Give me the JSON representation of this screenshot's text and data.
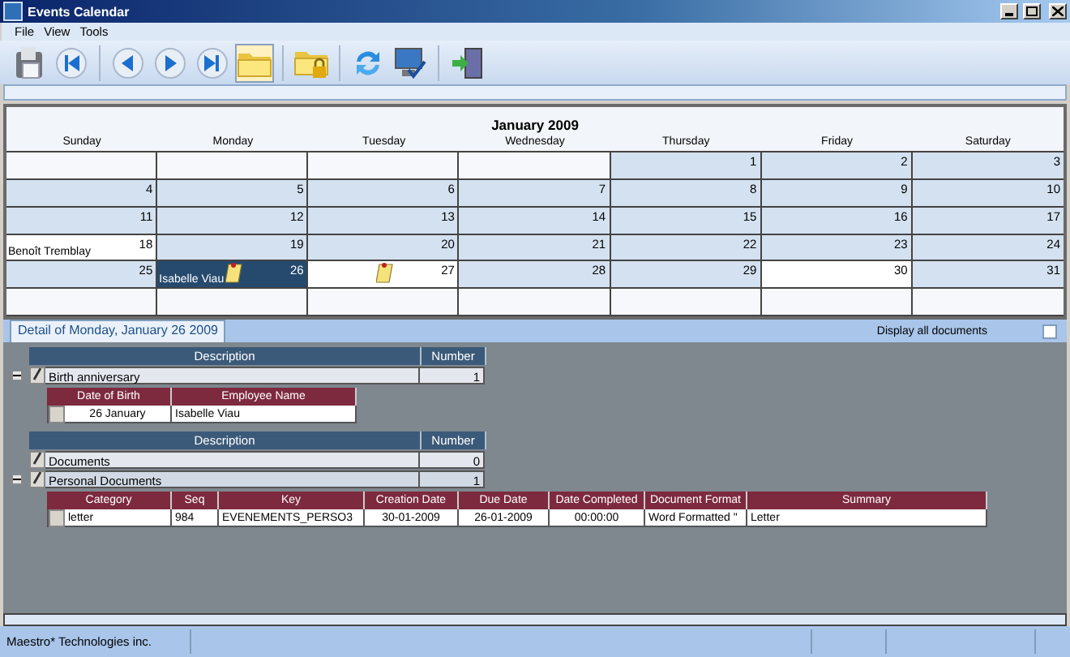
{
  "window": {
    "title": "Events Calendar"
  },
  "menu": [
    "File",
    "View",
    "Tools"
  ],
  "toolbar": [
    {
      "kind": "print",
      "selected": false
    },
    {
      "kind": "first",
      "selected": false
    },
    {
      "kind": "prev",
      "selected": false
    },
    {
      "kind": "next",
      "selected": false
    },
    {
      "kind": "last",
      "selected": false
    },
    {
      "kind": "folder",
      "selected": true
    },
    {
      "kind": "lockfolder",
      "selected": false
    },
    {
      "kind": "refresh",
      "selected": false
    },
    {
      "kind": "monitor",
      "selected": false
    },
    {
      "kind": "exit",
      "selected": false
    }
  ],
  "calendar": {
    "title": "January 2009",
    "days": [
      "Sunday",
      "Monday",
      "Tuesday",
      "Wednesday",
      "Thursday",
      "Friday",
      "Saturday"
    ],
    "weeks": [
      [
        {
          "kind": "blank"
        },
        {
          "kind": "blank"
        },
        {
          "kind": "blank"
        },
        {
          "kind": "blank"
        },
        {
          "kind": "month",
          "day": "1"
        },
        {
          "kind": "month",
          "day": "2"
        },
        {
          "kind": "month",
          "day": "3"
        }
      ],
      [
        {
          "kind": "month",
          "day": "4"
        },
        {
          "kind": "month",
          "day": "5"
        },
        {
          "kind": "month",
          "day": "6"
        },
        {
          "kind": "month",
          "day": "7"
        },
        {
          "kind": "month",
          "day": "8"
        },
        {
          "kind": "month",
          "day": "9"
        },
        {
          "kind": "month",
          "day": "10"
        }
      ],
      [
        {
          "kind": "month",
          "day": "11"
        },
        {
          "kind": "month",
          "day": "12"
        },
        {
          "kind": "month",
          "day": "13"
        },
        {
          "kind": "month",
          "day": "14"
        },
        {
          "kind": "month",
          "day": "15"
        },
        {
          "kind": "month",
          "day": "16"
        },
        {
          "kind": "month",
          "day": "17"
        }
      ],
      [
        {
          "kind": "marked",
          "day": "18",
          "event": "Benoît Tremblay"
        },
        {
          "kind": "month",
          "day": "19"
        },
        {
          "kind": "month",
          "day": "20"
        },
        {
          "kind": "month",
          "day": "21"
        },
        {
          "kind": "month",
          "day": "22"
        },
        {
          "kind": "month",
          "day": "23"
        },
        {
          "kind": "month",
          "day": "24"
        }
      ],
      [
        {
          "kind": "month",
          "day": "25"
        },
        {
          "kind": "month",
          "day": "26",
          "event": "Isabelle Viau",
          "note": true,
          "selected": true
        },
        {
          "kind": "marked",
          "day": "27",
          "note": true
        },
        {
          "kind": "month",
          "day": "28"
        },
        {
          "kind": "month",
          "day": "29"
        },
        {
          "kind": "marked",
          "day": "30"
        },
        {
          "kind": "month",
          "day": "31"
        }
      ],
      [
        {
          "kind": "blank"
        },
        {
          "kind": "blank"
        },
        {
          "kind": "blank"
        },
        {
          "kind": "blank"
        },
        {
          "kind": "blank"
        },
        {
          "kind": "blank"
        },
        {
          "kind": "blank"
        }
      ]
    ]
  },
  "detail": {
    "tab": "Detail of Monday, January 26 2009",
    "display_all": {
      "label": "Display all documents",
      "checked": false
    },
    "groups": [
      {
        "columns": [
          "Description",
          "Number"
        ],
        "rows": [
          {
            "description": "Birth anniversary",
            "number": "1",
            "expanded": true,
            "sub": {
              "columns": [
                "Date of Birth",
                "Employee Name"
              ],
              "rows": [
                [
                  "26 January",
                  "Isabelle Viau"
                ]
              ]
            }
          }
        ]
      },
      {
        "columns": [
          "Description",
          "Number"
        ],
        "rows": [
          {
            "description": "Documents",
            "number": "0"
          },
          {
            "description": "Personal Documents",
            "number": "1",
            "expanded": true,
            "sub": {
              "columns": [
                "Category",
                "Seq",
                "Key",
                "Creation Date",
                "Due Date",
                "Date Completed",
                "Document Format",
                "Summary"
              ],
              "rows": [
                [
                  "letter",
                  "984",
                  "EVENEMENTS_PERSO3",
                  "30-01-2009",
                  "26-01-2009",
                  "00:00:00",
                  "Word Formatted \"",
                  "Letter"
                ]
              ]
            }
          }
        ]
      }
    ]
  },
  "status_bar": [
    "Maestro* Technologies inc."
  ]
}
